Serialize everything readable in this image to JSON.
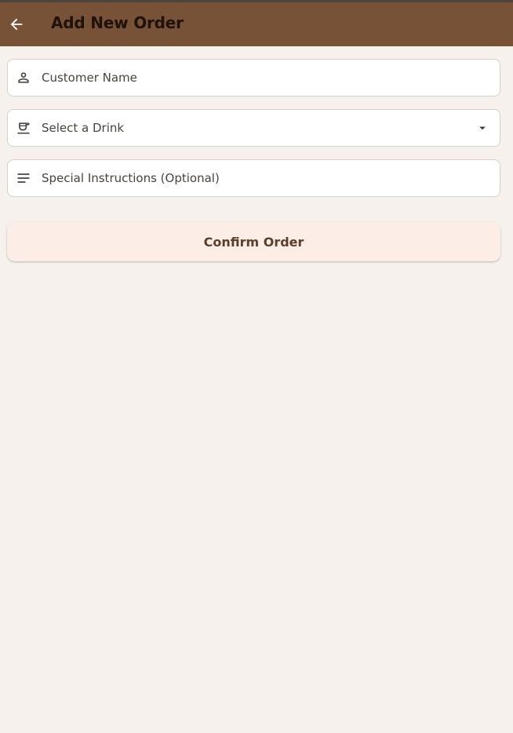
{
  "appbar": {
    "title": "Add New Order",
    "back_icon": "arrow-left-icon",
    "color": "#785237"
  },
  "form": {
    "customer_name": {
      "placeholder": "Customer Name",
      "icon": "person-icon"
    },
    "drink": {
      "placeholder": "Select a Drink",
      "icon": "coffee-cup-icon",
      "dropdown_icon": "caret-down-icon"
    },
    "instructions": {
      "placeholder": "Special Instructions (Optional)",
      "icon": "notes-icon"
    }
  },
  "confirm_button": {
    "label": "Confirm Order"
  }
}
